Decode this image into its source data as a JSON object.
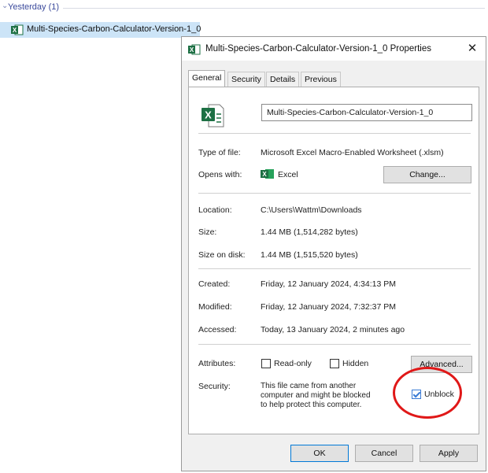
{
  "explorer": {
    "group_label": "Yesterday (1)",
    "file_name": "Multi-Species-Carbon-Calculator-Version-1_0"
  },
  "dialog": {
    "title": "Multi-Species-Carbon-Calculator-Version-1_0 Properties",
    "close_glyph": "✕",
    "tabs": [
      "General",
      "Security",
      "Details",
      "Previous Versions"
    ],
    "active_tab": "General",
    "filename_value": "Multi-Species-Carbon-Calculator-Version-1_0",
    "rows": {
      "type_label": "Type of file:",
      "type_value": "Microsoft Excel Macro-Enabled Worksheet (.xlsm)",
      "opens_label": "Opens with:",
      "opens_value": "Excel",
      "change_button": "Change...",
      "location_label": "Location:",
      "location_value": "C:\\Users\\Wattm\\Downloads",
      "size_label": "Size:",
      "size_value": "1.44 MB (1,514,282 bytes)",
      "disk_label": "Size on disk:",
      "disk_value": "1.44 MB (1,515,520 bytes)",
      "created_label": "Created:",
      "created_value": "Friday, 12 January 2024, 4:34:13 PM",
      "modified_label": "Modified:",
      "modified_value": "Friday, 12 January 2024, 7:32:37 PM",
      "accessed_label": "Accessed:",
      "accessed_value": "Today, 13 January 2024, 2 minutes ago",
      "attributes_label": "Attributes:",
      "readonly_label": "Read-only",
      "readonly_checked": false,
      "hidden_label": "Hidden",
      "hidden_checked": false,
      "advanced_button": "Advanced...",
      "security_label": "Security:",
      "security_text": "This file came from another computer and might be blocked to help protect this computer.",
      "unblock_label": "Unblock",
      "unblock_checked": true
    },
    "buttons": {
      "ok": "OK",
      "cancel": "Cancel",
      "apply": "Apply"
    }
  },
  "colors": {
    "selection": "#cce4f7",
    "excel_green": "#1d7044",
    "annotation_red": "#e01818",
    "link_blue": "#3b4a9c"
  }
}
